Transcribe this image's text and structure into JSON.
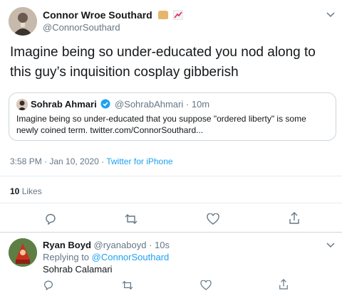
{
  "tweet": {
    "author_name": "Connor Wroe Southard",
    "author_handle": "@ConnorSouthard",
    "text": "Imagine being so under-educated you nod along to this guy’s inquisition cosplay gibberish",
    "quoted": {
      "author_name": "Sohrab Ahmari",
      "author_handle": "@SohrabAhmari",
      "separator": "·",
      "time": "10m",
      "text_line1": "Imagine being so under-educated that you suppose \"ordered liberty\" is some",
      "text_line2": "newly coined term. twitter.com/ConnorSouthard..."
    },
    "timestamp": "3:58 PM · Jan 10, 2020 · ",
    "source": "Twitter for iPhone",
    "likes_count": "10",
    "likes_label": "Likes"
  },
  "reply": {
    "author_name": "Ryan Boyd",
    "author_handle": "@ryanaboyd",
    "separator": "·",
    "time": "10s",
    "replying_prefix": "Replying to ",
    "replying_to": "@ConnorSouthard",
    "text": "Sohrab Calamari"
  },
  "colors": {
    "accent": "#1da1f2",
    "muted": "#657786",
    "divider": "#e6ecf0",
    "text": "#14171a"
  },
  "icons": {
    "action_bar": [
      "reply-icon",
      "retweet-icon",
      "like-icon",
      "share-icon"
    ],
    "menu": "chevron-down-icon",
    "verified": "verified-badge-icon"
  }
}
